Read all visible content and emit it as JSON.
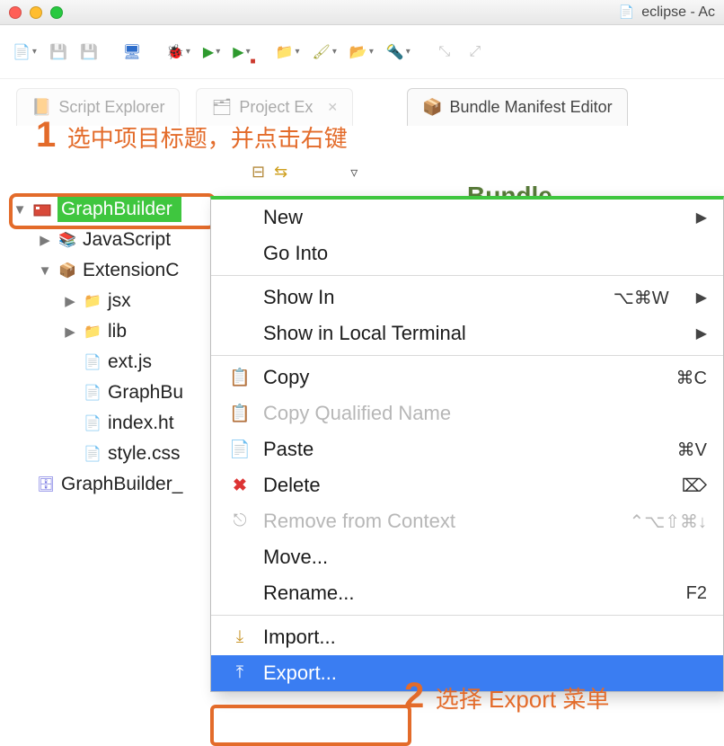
{
  "titlebar": {
    "title": "eclipse - Ac"
  },
  "annotations": {
    "one_num": "1",
    "one_text": "选中项目标题，并点击右键",
    "two_num": "2",
    "two_text": "选择 Export 菜单"
  },
  "tabs": {
    "explorer": "Script Explorer",
    "project": "Project Ex",
    "editor": "Bundle Manifest Editor"
  },
  "bundle": {
    "header": "Bundle"
  },
  "tree": {
    "root": "GraphBuilder",
    "items": [
      "JavaScript",
      "ExtensionC",
      "jsx",
      "lib",
      "ext.js",
      "GraphBu",
      "index.ht",
      "style.css",
      "GraphBuilder_"
    ]
  },
  "menu": {
    "new": "New",
    "go_into": "Go Into",
    "show_in": "Show In",
    "show_in_sc": "⌥⌘W",
    "show_terminal": "Show in Local Terminal",
    "copy": "Copy",
    "copy_sc": "⌘C",
    "copy_qual": "Copy Qualified Name",
    "paste": "Paste",
    "paste_sc": "⌘V",
    "delete": "Delete",
    "delete_sc": "⌦",
    "remove_ctx": "Remove from Context",
    "remove_ctx_sc": "⌃⌥⇧⌘↓",
    "move": "Move...",
    "rename": "Rename...",
    "rename_sc": "F2",
    "import": "Import...",
    "export": "Export..."
  }
}
